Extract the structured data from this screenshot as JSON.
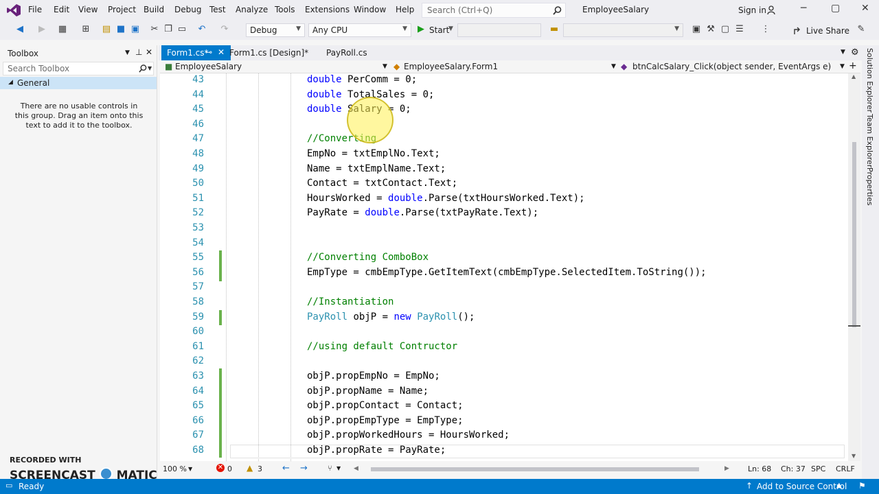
{
  "titlebar": {
    "menus": [
      "File",
      "Edit",
      "View",
      "Project",
      "Build",
      "Debug",
      "Test",
      "Analyze",
      "Tools",
      "Extensions",
      "Window",
      "Help"
    ],
    "search_placeholder": "Search (Ctrl+Q)",
    "solution_name": "EmployeeSalary",
    "signin_label": "Sign in"
  },
  "toolbar": {
    "configuration": "Debug",
    "platform": "Any CPU",
    "start_label": "Start",
    "live_share_label": "Live Share"
  },
  "toolbox": {
    "title": "Toolbox",
    "search_placeholder": "Search Toolbox",
    "group": "General",
    "empty_message": "There are no usable controls in this group. Drag an item onto this text to add it to the toolbox."
  },
  "tabs": [
    {
      "label": "Form1.cs*"
    },
    {
      "label": "Form1.cs [Design]*"
    },
    {
      "label": "PayRoll.cs"
    }
  ],
  "navbar": {
    "project": "EmployeeSalary",
    "class": "EmployeeSalary.Form1",
    "member": "btnCalcSalary_Click(object sender, EventArgs e)"
  },
  "code_lines": [
    {
      "n": "43",
      "t": "double PerComm = 0;"
    },
    {
      "n": "44",
      "t": "double TotalSales = 0;"
    },
    {
      "n": "45",
      "t": "double Salary = 0;"
    },
    {
      "n": "46",
      "t": ""
    },
    {
      "n": "47",
      "t": "//Converting"
    },
    {
      "n": "48",
      "t": "EmpNo = txtEmplNo.Text;"
    },
    {
      "n": "49",
      "t": "Name = txtEmplName.Text;"
    },
    {
      "n": "50",
      "t": "Contact = txtContact.Text;"
    },
    {
      "n": "51",
      "t": "HoursWorked = double.Parse(txtHoursWorked.Text);"
    },
    {
      "n": "52",
      "t": "PayRate = double.Parse(txtPayRate.Text);"
    },
    {
      "n": "53",
      "t": ""
    },
    {
      "n": "54",
      "t": ""
    },
    {
      "n": "55",
      "t": "//Converting ComboBox"
    },
    {
      "n": "56",
      "t": "EmpType = cmbEmpType.GetItemText(cmbEmpType.SelectedItem.ToString());"
    },
    {
      "n": "57",
      "t": ""
    },
    {
      "n": "58",
      "t": "//Instantiation"
    },
    {
      "n": "59",
      "t": "PayRoll objP = new PayRoll();"
    },
    {
      "n": "60",
      "t": ""
    },
    {
      "n": "61",
      "t": "//using default Contructor"
    },
    {
      "n": "62",
      "t": ""
    },
    {
      "n": "63",
      "t": "objP.propEmpNo = EmpNo;"
    },
    {
      "n": "64",
      "t": "objP.propName = Name;"
    },
    {
      "n": "65",
      "t": "objP.propContact = Contact;"
    },
    {
      "n": "66",
      "t": "objP.propEmpType = EmpType;"
    },
    {
      "n": "67",
      "t": "objP.propWorkedHours = HoursWorked;"
    },
    {
      "n": "68",
      "t": "objP.propRate = PayRate;"
    }
  ],
  "editor_status": {
    "zoom": "100 %",
    "errors": "0",
    "warnings": "3",
    "line": "Ln: 68",
    "col": "Ch: 37",
    "spc": "SPC",
    "crlf": "CRLF"
  },
  "statusbar": {
    "state": "Ready",
    "source_control": "Add to Source Control"
  },
  "right_rail": [
    "Solution Explorer",
    "Team Explorer",
    "Properties"
  ],
  "watermark": {
    "line1": "RECORDED WITH",
    "line2": "SCREENCAST",
    "line3": "MATIC"
  },
  "colors": {
    "accent": "#007acc",
    "keyword": "#0000ff",
    "comment": "#008000",
    "type": "#2b91af"
  }
}
